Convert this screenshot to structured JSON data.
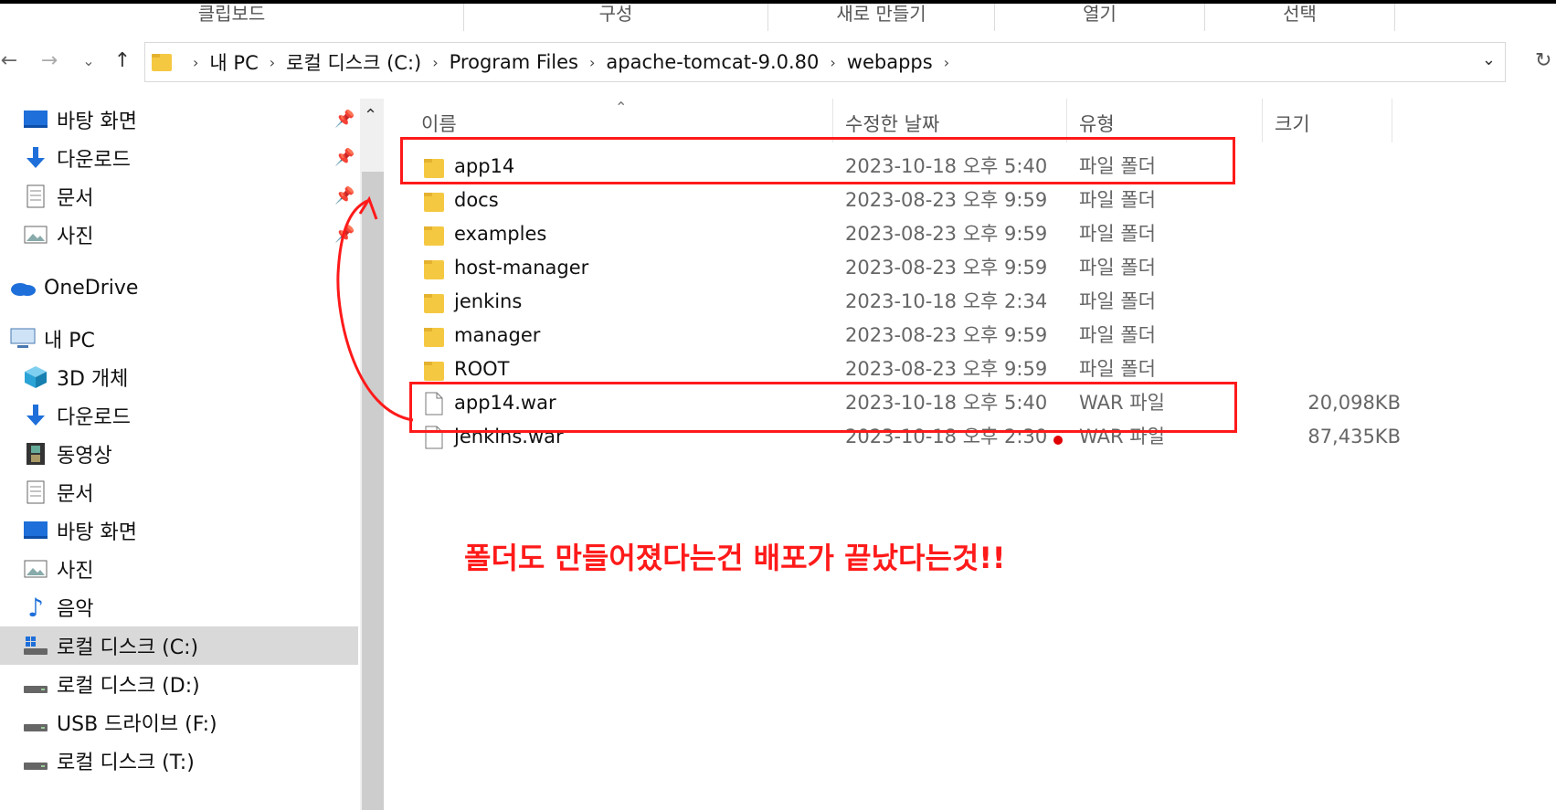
{
  "ribbon": {
    "groups": [
      "클립보드",
      "구성",
      "새로 만들기",
      "열기",
      "선택"
    ]
  },
  "nav": {
    "back_icon": "arrow-left-icon",
    "forward_icon": "arrow-right-icon",
    "recent_icon": "chevron-down-icon",
    "up_icon": "arrow-up-icon",
    "breadcrumbs": [
      "내 PC",
      "로컬 디스크 (C:)",
      "Program Files",
      "apache-tomcat-9.0.80",
      "webapps"
    ],
    "refresh_icon": "refresh-icon"
  },
  "sidebar": {
    "quick_access": [
      {
        "label": "바탕 화면",
        "icon": "desktop-icon",
        "pinned": true
      },
      {
        "label": "다운로드",
        "icon": "download-icon",
        "pinned": true
      },
      {
        "label": "문서",
        "icon": "document-icon",
        "pinned": true
      },
      {
        "label": "사진",
        "icon": "picture-icon",
        "pinned": true
      }
    ],
    "onedrive": "OneDrive",
    "this_pc": "내 PC",
    "pc_items": [
      {
        "label": "3D 개체",
        "icon": "cube-icon"
      },
      {
        "label": "다운로드",
        "icon": "download-icon"
      },
      {
        "label": "동영상",
        "icon": "film-icon"
      },
      {
        "label": "문서",
        "icon": "document-icon"
      },
      {
        "label": "바탕 화면",
        "icon": "desktop-icon"
      },
      {
        "label": "사진",
        "icon": "picture-icon"
      },
      {
        "label": "음악",
        "icon": "music-icon"
      },
      {
        "label": "로컬 디스크 (C:)",
        "icon": "windows-drive-icon",
        "selected": true
      },
      {
        "label": "로컬 디스크 (D:)",
        "icon": "drive-icon"
      },
      {
        "label": "USB 드라이브 (F:)",
        "icon": "drive-icon"
      },
      {
        "label": "로컬 디스크 (T:)",
        "icon": "drive-icon"
      }
    ]
  },
  "columns": {
    "name": "이름",
    "date": "수정한 날짜",
    "type": "유형",
    "size": "크기"
  },
  "files": [
    {
      "name": "app14",
      "date": "2023-10-18 오후 5:40",
      "type": "파일 폴더",
      "size": "",
      "kind": "folder"
    },
    {
      "name": "docs",
      "date": "2023-08-23 오후 9:59",
      "type": "파일 폴더",
      "size": "",
      "kind": "folder"
    },
    {
      "name": "examples",
      "date": "2023-08-23 오후 9:59",
      "type": "파일 폴더",
      "size": "",
      "kind": "folder"
    },
    {
      "name": "host-manager",
      "date": "2023-08-23 오후 9:59",
      "type": "파일 폴더",
      "size": "",
      "kind": "folder"
    },
    {
      "name": "jenkins",
      "date": "2023-10-18 오후 2:34",
      "type": "파일 폴더",
      "size": "",
      "kind": "folder"
    },
    {
      "name": "manager",
      "date": "2023-08-23 오후 9:59",
      "type": "파일 폴더",
      "size": "",
      "kind": "folder"
    },
    {
      "name": "ROOT",
      "date": "2023-08-23 오후 9:59",
      "type": "파일 폴더",
      "size": "",
      "kind": "folder"
    },
    {
      "name": "app14.war",
      "date": "2023-10-18 오후 5:40",
      "type": "WAR 파일",
      "size": "20,098KB",
      "kind": "file"
    },
    {
      "name": "jenkins.war",
      "date": "2023-10-18 오후 2:30",
      "type": "WAR 파일",
      "size": "87,435KB",
      "kind": "file"
    }
  ],
  "annotation": {
    "text": "폴더도 만들어졌다는건 배포가 끝났다는것!!",
    "color": "#ff1a1a"
  },
  "colors": {
    "folder": "#f5c842",
    "selected_bg": "#d9d9d9",
    "accent_blue": "#1e6fd9"
  }
}
